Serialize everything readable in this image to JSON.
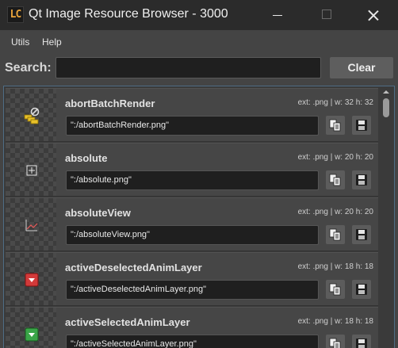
{
  "window": {
    "title": "Qt Image Resource Browser - 3000",
    "logo_text": "LC"
  },
  "menu": {
    "items": [
      "Utils",
      "Help"
    ]
  },
  "search": {
    "label": "Search:",
    "value": "",
    "placeholder": "",
    "clear_label": "Clear"
  },
  "resources": [
    {
      "name": "abortBatchRender",
      "meta": "ext: .png  |  w: 32  h: 32",
      "path": "\":/abortBatchRender.png\"",
      "icon": "abort-batch-render-icon"
    },
    {
      "name": "absolute",
      "meta": "ext: .png  |  w: 20  h: 20",
      "path": "\":/absolute.png\"",
      "icon": "absolute-icon"
    },
    {
      "name": "absoluteView",
      "meta": "ext: .png  |  w: 20  h: 20",
      "path": "\":/absoluteView.png\"",
      "icon": "absolute-view-icon"
    },
    {
      "name": "activeDeselectedAnimLayer",
      "meta": "ext: .png  |  w: 18  h: 18",
      "path": "\":/activeDeselectedAnimLayer.png\"",
      "icon": "active-deselected-anim-layer-icon"
    },
    {
      "name": "activeSelectedAnimLayer",
      "meta": "ext: .png  |  w: 18  h: 18",
      "path": "\":/activeSelectedAnimLayer.png\"",
      "icon": "active-selected-anim-layer-icon"
    }
  ],
  "colors": {
    "title_bar": "#2b2b2b",
    "background": "#444444",
    "frame_accent": "#4f6d85",
    "anim_deselected": "#d23a3a",
    "anim_selected": "#3aa548",
    "batch_yellow": "#e8c12a"
  }
}
